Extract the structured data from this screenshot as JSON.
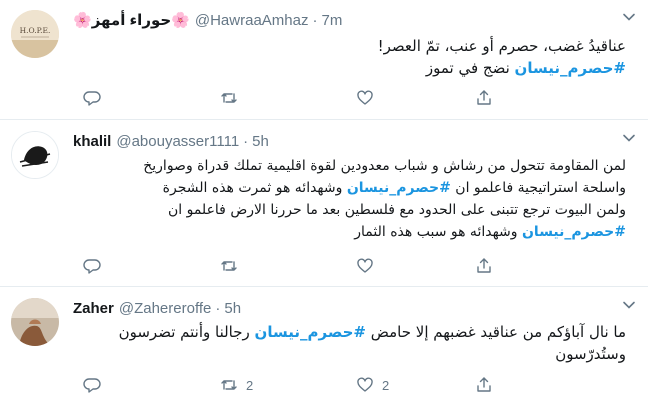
{
  "colors": {
    "link": "#1b95e0",
    "text": "#14171a",
    "muted": "#657786",
    "border": "#e6ecf0"
  },
  "tweets": [
    {
      "name": "🌸حوراء أمهز🌸",
      "handle": "@HawraaAmhaz",
      "sep": "·",
      "time": "7m",
      "avatar_text": "H.O.P.E.",
      "line1": "عناقيدُ غضب، حصرم أو عنب، تمّ العصر!",
      "hashtag": "#حصرم_نيسان",
      "line2_rest": " نضج في تموز",
      "reply_count": "",
      "retweet_count": "",
      "like_count": ""
    },
    {
      "name": "khalil",
      "handle": "@abouyasser1111",
      "sep": "·",
      "time": "5h",
      "line1": "لمن المقاومة تتحول من رشاش و شباب معدودين لقوة اقليمية تملك قدراة وصواريخ",
      "line2_pre": "واسلحة استراتيجية فاعلمو ان ",
      "hashtag1": "#حصرم_نيسان",
      "line2_post": " وشهدائه هو ثمرت هذه الشجرة",
      "line3": "ولمن البيوت ترجع تتبنى على الحدود مع فلسطين بعد ما حررنا الارض فاعلمو ان",
      "hashtag2": "#حصرم_نيسان",
      "line4_post": " وشهدائه هو سبب هذه الثمار",
      "reply_count": "",
      "retweet_count": "",
      "like_count": ""
    },
    {
      "name": "Zaher",
      "handle": "@Zahereroffe",
      "sep": "·",
      "time": "5h",
      "line1_pre": "ما نال آباؤكم من عناقيد غضبهم إلا حامض ",
      "hashtag": "#حصرم_نيسان",
      "line1_post": " رجالنا وأنتم تضرسون",
      "line2": "وستُدرّسون",
      "reply_count": "",
      "retweet_count": "2",
      "like_count": "2"
    }
  ]
}
